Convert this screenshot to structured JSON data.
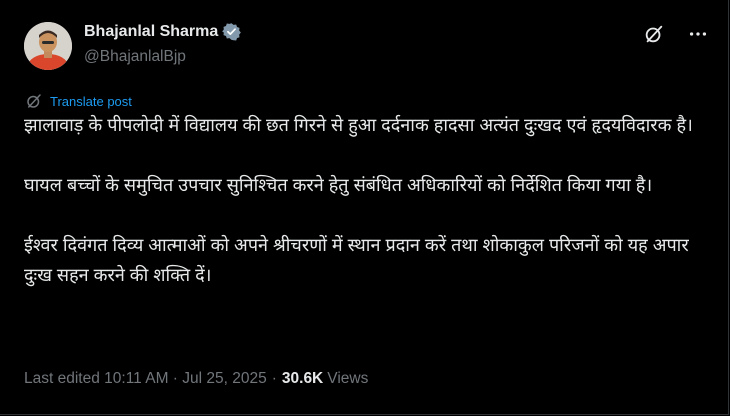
{
  "author": {
    "name": "Bhajanlal Sharma",
    "handle": "@BhajanlalBjp",
    "verified_color": "#1d9bf0"
  },
  "translate": {
    "label": "Translate post",
    "icon": "globe-icon"
  },
  "tweet": {
    "paragraphs": [
      "झालावाड़ के पीपलोदी में विद्यालय की छत गिरने से हुआ दर्दनाक हादसा अत्यंत दुःखद एवं हृदयविदारक है।",
      "घायल बच्चों के समुचित उपचार सुनिश्चित करने हेतु संबंधित अधिकारियों को निर्देशित किया गया है।",
      "ईश्वर दिवंगत दिव्य आत्माओं को अपने श्रीचरणों में स्थान प्रदान करें तथा शोकाकुल परिजनों को यह अपार दुःख सहन करने की शक्ति दें।"
    ]
  },
  "meta": {
    "edited": "Last edited 10:11 AM · Jul 25, 2025",
    "separator": "·",
    "views_count": "30.6K",
    "views_label": "Views"
  },
  "colors": {
    "background": "#000000",
    "text": "#e7e9ea",
    "muted": "#71767b",
    "accent": "#1d9bf0"
  }
}
